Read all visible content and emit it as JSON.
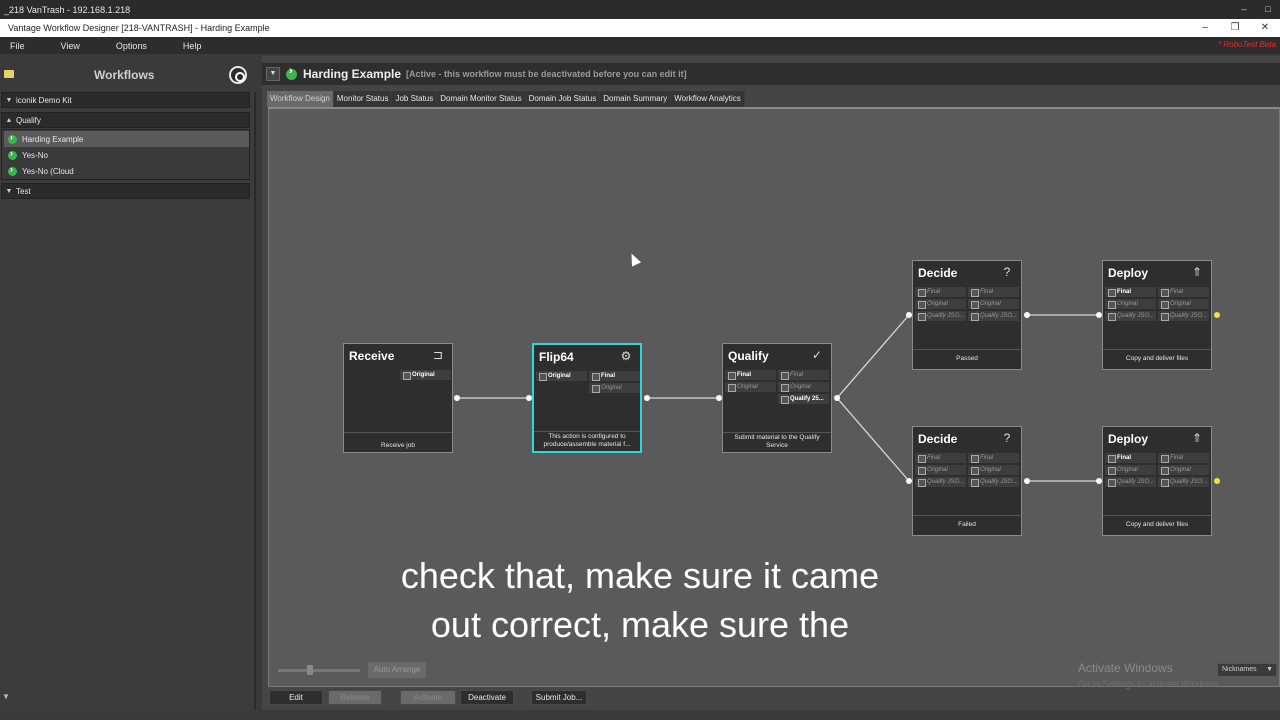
{
  "remote_session": {
    "title": "_218 VanTrash - 192.168.1.218",
    "minimize": "–",
    "maximize": "□"
  },
  "window": {
    "title": "Vantage Workflow Designer [218-VANTRASH] - Harding Example",
    "minimize": "–",
    "restore": "❐",
    "close": "✕"
  },
  "menu": {
    "items": [
      "File",
      "View",
      "Options",
      "Help"
    ],
    "notice": "* RoboTest Beta"
  },
  "sidebar": {
    "title": "Workflows",
    "groups": [
      {
        "label": "iconik Demo Kit",
        "expanded": false,
        "items": []
      },
      {
        "label": "Qualify",
        "expanded": true,
        "items": [
          "Harding Example",
          "Yes-No",
          "Yes-No (Cloud"
        ]
      },
      {
        "label": "Test",
        "expanded": false,
        "items": []
      }
    ],
    "selected_item": "Harding Example"
  },
  "workflow": {
    "name": "Harding Example",
    "status": "[Active - this workflow must be deactivated before you can edit it]"
  },
  "tabs": [
    "Workflow Design",
    "Monitor Status",
    "Job Status",
    "Domain Monitor Status",
    "Domain Job Status",
    "Domain Summary",
    "Workflow Analytics"
  ],
  "active_tab": "Workflow Design",
  "nodes": {
    "receive": {
      "title": "Receive",
      "icon": "receive-icon",
      "vars": [
        "Original"
      ],
      "desc": "Receive job"
    },
    "flip64": {
      "title": "Flip64",
      "icon": "gears-icon",
      "vars_in": [
        "Original"
      ],
      "vars_out": [
        "Final",
        "Original"
      ],
      "desc": "This action is configured to produce/assemble material f..."
    },
    "qualify": {
      "title": "Qualify",
      "icon": "check-circle-icon",
      "vars_in": [
        "Final",
        "Original"
      ],
      "vars_out": [
        "Final",
        "Original",
        "Qualify 25..."
      ],
      "desc": "Submit material to the Qualify Service"
    },
    "decide_top": {
      "title": "Decide",
      "icon": "question-icon",
      "vars_in": [
        "Final",
        "Original",
        "Qualify JSO..."
      ],
      "vars_out": [
        "Final",
        "Original",
        "Qualify JSO..."
      ],
      "desc": "Passed"
    },
    "deploy_top": {
      "title": "Deploy",
      "icon": "deploy-icon",
      "vars_in": [
        "Final",
        "Original",
        "Qualify JSO..."
      ],
      "vars_out": [
        "Final",
        "Original",
        "Qualify JSO..."
      ],
      "desc": "Copy and deliver files"
    },
    "decide_bottom": {
      "title": "Decide",
      "icon": "question-icon",
      "vars_in": [
        "Final",
        "Original",
        "Qualify JSO..."
      ],
      "vars_out": [
        "Final",
        "Original",
        "Qualify JSO..."
      ],
      "desc": "Failed"
    },
    "deploy_bottom": {
      "title": "Deploy",
      "icon": "deploy-icon",
      "vars_in": [
        "Final",
        "Original",
        "Qualify JSO..."
      ],
      "vars_out": [
        "Final",
        "Original",
        "Qualify JSO..."
      ],
      "desc": "Copy and deliver files"
    }
  },
  "canvas_controls": {
    "auto_arrange": "Auto Arrange",
    "nicknames": "Nicknames"
  },
  "watermark": {
    "line1": "Activate Windows",
    "line2": "Go to Settings to activate Windows."
  },
  "buttons": {
    "edit": "Edit",
    "release": "Release",
    "activate": "Activate",
    "deactivate": "Deactivate",
    "submit_job": "Submit Job..."
  },
  "caption": {
    "line1": "check that, make sure it came",
    "line2": "out correct, make sure the"
  },
  "colors": {
    "selected_node_border": "#2fd6d6",
    "active_green": "#3fb54a",
    "output_port": "#f2e23a"
  }
}
